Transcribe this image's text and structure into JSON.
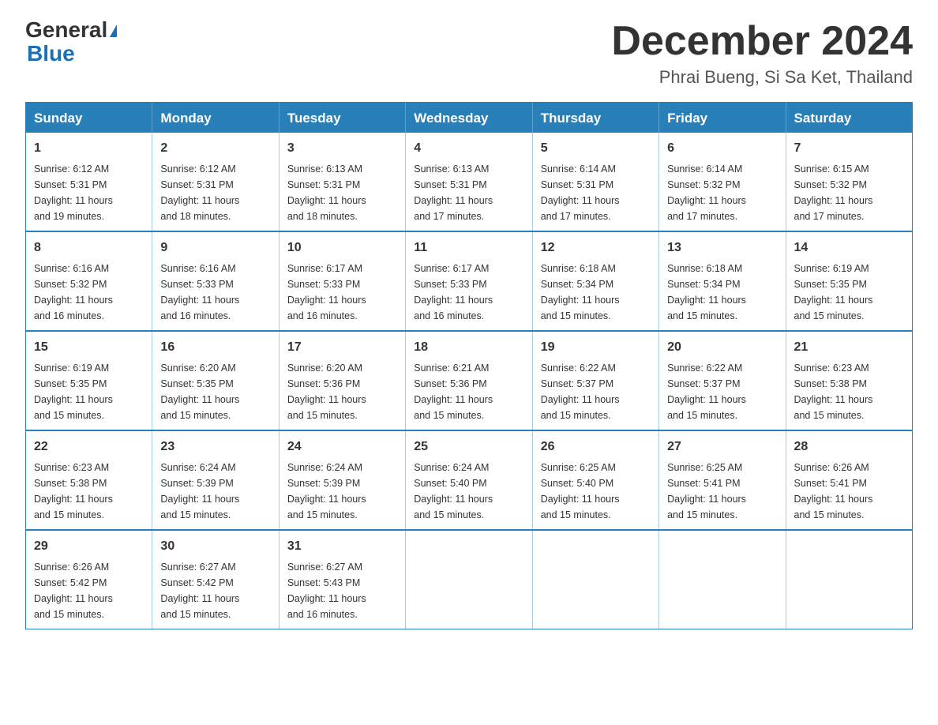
{
  "logo": {
    "general": "General",
    "blue": "Blue"
  },
  "header": {
    "month_title": "December 2024",
    "location": "Phrai Bueng, Si Sa Ket, Thailand"
  },
  "days_of_week": [
    "Sunday",
    "Monday",
    "Tuesday",
    "Wednesday",
    "Thursday",
    "Friday",
    "Saturday"
  ],
  "weeks": [
    [
      {
        "day": "1",
        "sunrise": "6:12 AM",
        "sunset": "5:31 PM",
        "daylight": "11 hours and 19 minutes."
      },
      {
        "day": "2",
        "sunrise": "6:12 AM",
        "sunset": "5:31 PM",
        "daylight": "11 hours and 18 minutes."
      },
      {
        "day": "3",
        "sunrise": "6:13 AM",
        "sunset": "5:31 PM",
        "daylight": "11 hours and 18 minutes."
      },
      {
        "day": "4",
        "sunrise": "6:13 AM",
        "sunset": "5:31 PM",
        "daylight": "11 hours and 17 minutes."
      },
      {
        "day": "5",
        "sunrise": "6:14 AM",
        "sunset": "5:31 PM",
        "daylight": "11 hours and 17 minutes."
      },
      {
        "day": "6",
        "sunrise": "6:14 AM",
        "sunset": "5:32 PM",
        "daylight": "11 hours and 17 minutes."
      },
      {
        "day": "7",
        "sunrise": "6:15 AM",
        "sunset": "5:32 PM",
        "daylight": "11 hours and 17 minutes."
      }
    ],
    [
      {
        "day": "8",
        "sunrise": "6:16 AM",
        "sunset": "5:32 PM",
        "daylight": "11 hours and 16 minutes."
      },
      {
        "day": "9",
        "sunrise": "6:16 AM",
        "sunset": "5:33 PM",
        "daylight": "11 hours and 16 minutes."
      },
      {
        "day": "10",
        "sunrise": "6:17 AM",
        "sunset": "5:33 PM",
        "daylight": "11 hours and 16 minutes."
      },
      {
        "day": "11",
        "sunrise": "6:17 AM",
        "sunset": "5:33 PM",
        "daylight": "11 hours and 16 minutes."
      },
      {
        "day": "12",
        "sunrise": "6:18 AM",
        "sunset": "5:34 PM",
        "daylight": "11 hours and 15 minutes."
      },
      {
        "day": "13",
        "sunrise": "6:18 AM",
        "sunset": "5:34 PM",
        "daylight": "11 hours and 15 minutes."
      },
      {
        "day": "14",
        "sunrise": "6:19 AM",
        "sunset": "5:35 PM",
        "daylight": "11 hours and 15 minutes."
      }
    ],
    [
      {
        "day": "15",
        "sunrise": "6:19 AM",
        "sunset": "5:35 PM",
        "daylight": "11 hours and 15 minutes."
      },
      {
        "day": "16",
        "sunrise": "6:20 AM",
        "sunset": "5:35 PM",
        "daylight": "11 hours and 15 minutes."
      },
      {
        "day": "17",
        "sunrise": "6:20 AM",
        "sunset": "5:36 PM",
        "daylight": "11 hours and 15 minutes."
      },
      {
        "day": "18",
        "sunrise": "6:21 AM",
        "sunset": "5:36 PM",
        "daylight": "11 hours and 15 minutes."
      },
      {
        "day": "19",
        "sunrise": "6:22 AM",
        "sunset": "5:37 PM",
        "daylight": "11 hours and 15 minutes."
      },
      {
        "day": "20",
        "sunrise": "6:22 AM",
        "sunset": "5:37 PM",
        "daylight": "11 hours and 15 minutes."
      },
      {
        "day": "21",
        "sunrise": "6:23 AM",
        "sunset": "5:38 PM",
        "daylight": "11 hours and 15 minutes."
      }
    ],
    [
      {
        "day": "22",
        "sunrise": "6:23 AM",
        "sunset": "5:38 PM",
        "daylight": "11 hours and 15 minutes."
      },
      {
        "day": "23",
        "sunrise": "6:24 AM",
        "sunset": "5:39 PM",
        "daylight": "11 hours and 15 minutes."
      },
      {
        "day": "24",
        "sunrise": "6:24 AM",
        "sunset": "5:39 PM",
        "daylight": "11 hours and 15 minutes."
      },
      {
        "day": "25",
        "sunrise": "6:24 AM",
        "sunset": "5:40 PM",
        "daylight": "11 hours and 15 minutes."
      },
      {
        "day": "26",
        "sunrise": "6:25 AM",
        "sunset": "5:40 PM",
        "daylight": "11 hours and 15 minutes."
      },
      {
        "day": "27",
        "sunrise": "6:25 AM",
        "sunset": "5:41 PM",
        "daylight": "11 hours and 15 minutes."
      },
      {
        "day": "28",
        "sunrise": "6:26 AM",
        "sunset": "5:41 PM",
        "daylight": "11 hours and 15 minutes."
      }
    ],
    [
      {
        "day": "29",
        "sunrise": "6:26 AM",
        "sunset": "5:42 PM",
        "daylight": "11 hours and 15 minutes."
      },
      {
        "day": "30",
        "sunrise": "6:27 AM",
        "sunset": "5:42 PM",
        "daylight": "11 hours and 15 minutes."
      },
      {
        "day": "31",
        "sunrise": "6:27 AM",
        "sunset": "5:43 PM",
        "daylight": "11 hours and 16 minutes."
      },
      null,
      null,
      null,
      null
    ]
  ],
  "labels": {
    "sunrise": "Sunrise:",
    "sunset": "Sunset:",
    "daylight": "Daylight:"
  }
}
